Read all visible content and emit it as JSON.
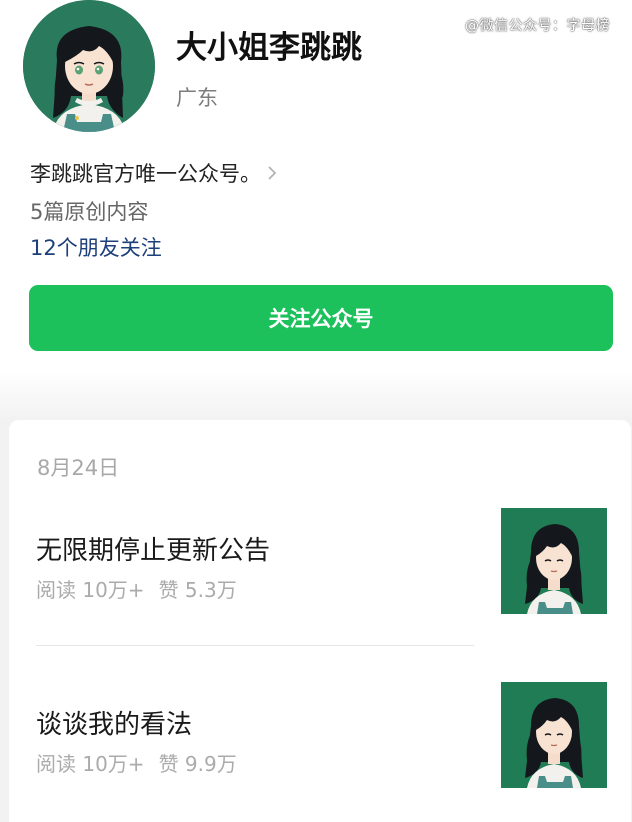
{
  "watermark": "@微信公众号：字母榜",
  "profile": {
    "name": "大小姐李跳跳",
    "region": "广东",
    "description": "李跳跳官方唯一公众号。",
    "original_count": "5篇原创内容",
    "friends_following": "12个朋友关注",
    "follow_button": "关注公众号",
    "avatar_icon": "cartoon-girl-avatar"
  },
  "feed": {
    "date": "8月24日",
    "articles": [
      {
        "title": "无限期停止更新公告",
        "reads": "阅读 10万+",
        "likes": "赞 5.3万",
        "thumb_icon": "cartoon-girl-thumbnail"
      },
      {
        "title": "谈谈我的看法",
        "reads": "阅读 10万+",
        "likes": "赞 9.9万",
        "thumb_icon": "cartoon-girl-thumbnail"
      }
    ]
  },
  "colors": {
    "accent_green": "#1cc15c",
    "link_blue": "#1d3f7a",
    "avatar_bg": "#2a7a5e",
    "thumb_bg": "#1f7c55"
  }
}
